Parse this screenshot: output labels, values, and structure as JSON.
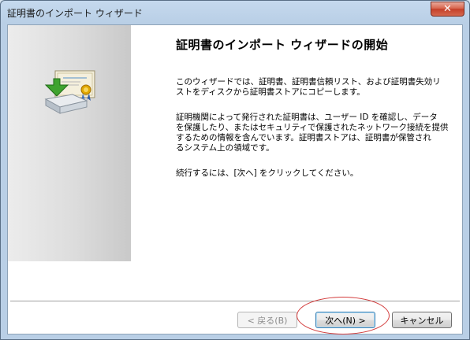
{
  "window": {
    "title": "証明書のインポート ウィザード",
    "close_label": "✕"
  },
  "page": {
    "heading": "証明書のインポート ウィザードの開始",
    "para1_line1": "このウィザードでは、証明書、証明書信頼リスト、および証明書失効リ",
    "para1_line2": "ストをディスクから証明書ストアにコピーします。",
    "para2_line1": "証明機関によって発行された証明書は、ユーザー ID を確認し、データ",
    "para2_line2": "を保護したり、またはセキュリティで保護されたネットワーク接続を提供",
    "para2_line3": "するための情報を含んでいます。証明書ストアは、証明書が保管され",
    "para2_line4": "るシステム上の領域です。",
    "para3": "続行するには、[次へ] をクリックしてください。"
  },
  "buttons": {
    "back": "< 戻る(B)",
    "next": "次へ(N) >",
    "cancel": "キャンセル"
  },
  "icons": {
    "wizard_icon": "certificate-import-icon",
    "close": "close-icon"
  },
  "colors": {
    "highlight": "#d23a3a",
    "close_button": "#c5402a"
  }
}
